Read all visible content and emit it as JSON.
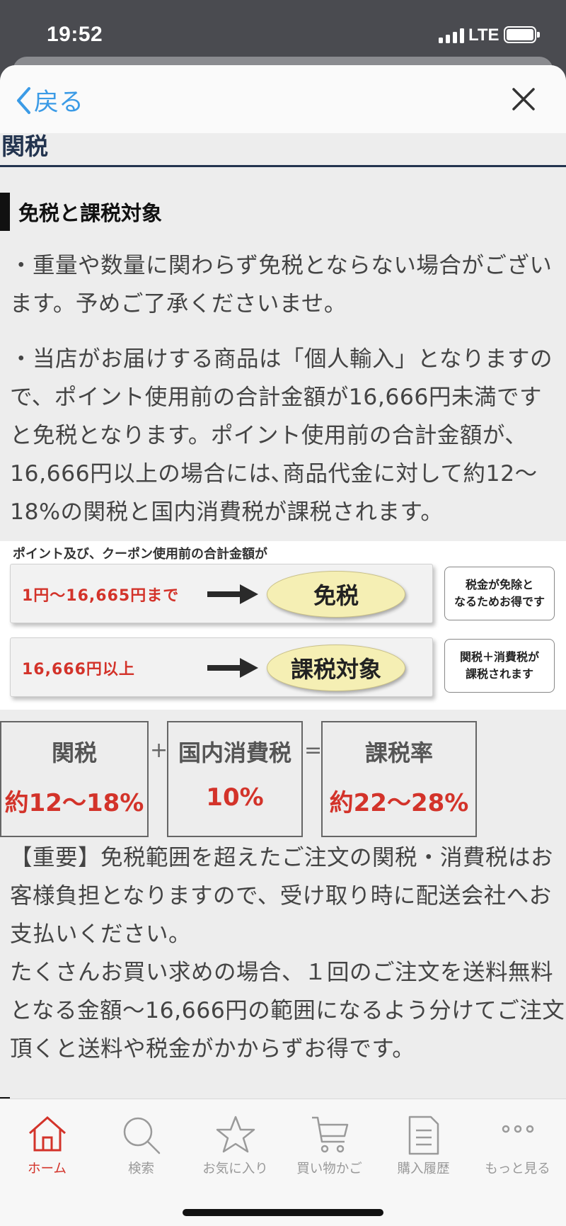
{
  "status_bar": {
    "time": "19:52",
    "network": "LTE"
  },
  "nav": {
    "back_label": "戻る"
  },
  "content": {
    "section_title": "関税",
    "sub_heading": "免税と課税対象",
    "para1": "・重量や数量に関わらず免税とならない場合がございます。予めご了承くださいませ。",
    "para2": "・当店がお届けする商品は「個人輸入」となりますので、ポイント使用前の合計金額が16,666円未満ですと免税となります。ポイント使用前の合計金額が、16,666円以上の場合には､商品代金に対して約12〜18%の関税と国内消費税が課税されます。",
    "image": {
      "caption": "ポイント及び、クーポン使用前の合計金額が",
      "tiers": [
        {
          "amount": "1円〜16,665円まで",
          "result": "免税",
          "note_line1": "税金が免除と",
          "note_line2": "なるためお得です"
        },
        {
          "amount": "16,666円以上",
          "result": "課税対象",
          "note_line1": "関税＋消費税が",
          "note_line2": "課税されます"
        }
      ]
    },
    "formula": {
      "items": [
        {
          "label": "関税",
          "value": "約12〜18%"
        },
        {
          "label": "国内消費税",
          "value": "10%"
        },
        {
          "label": "課税率",
          "value": "約22〜28%"
        }
      ],
      "plus": "+",
      "equals": "="
    },
    "para3_line1": "【重要】免税範囲を超えたご注文の関税・消費税はお客様負担となりますので、受け取り時に配送会社へお支払いください。",
    "para3_line2": "たくさんお買い求めの場合、１回のご注文を送料無料となる金額〜16,666円の範囲になるよう分けてご注文頂くと送料や税金がかからずお得です。"
  },
  "tabs": [
    {
      "label": "ホーム",
      "icon": "home-icon",
      "active": true
    },
    {
      "label": "検索",
      "icon": "search-icon"
    },
    {
      "label": "お気に入り",
      "icon": "star-icon"
    },
    {
      "label": "買い物かご",
      "icon": "cart-icon"
    },
    {
      "label": "購入履歴",
      "icon": "history-icon"
    },
    {
      "label": "もっと見る",
      "icon": "more-icon"
    }
  ],
  "colors": {
    "accent_red": "#d3332a",
    "link_blue": "#3b9be6",
    "heading_navy": "#23344f"
  }
}
